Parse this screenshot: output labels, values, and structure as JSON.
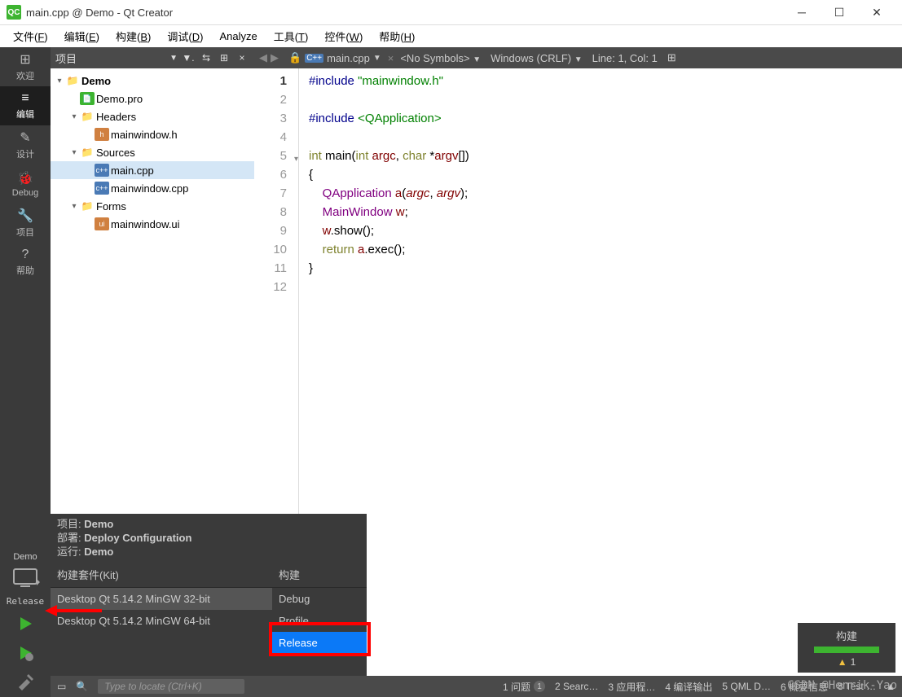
{
  "window": {
    "title": "main.cpp @ Demo - Qt Creator",
    "logo_text": "QC"
  },
  "menu": [
    {
      "label": "文件",
      "key": "F"
    },
    {
      "label": "编辑",
      "key": "E"
    },
    {
      "label": "构建",
      "key": "B"
    },
    {
      "label": "调试",
      "key": "D"
    },
    {
      "label": "Analyze",
      "key": ""
    },
    {
      "label": "工具",
      "key": "T"
    },
    {
      "label": "控件",
      "key": "W"
    },
    {
      "label": "帮助",
      "key": "H"
    }
  ],
  "sidebar": {
    "items": [
      {
        "id": "welcome",
        "label": "欢迎",
        "icon": "⊞"
      },
      {
        "id": "edit",
        "label": "编辑",
        "icon": "≡",
        "active": true
      },
      {
        "id": "design",
        "label": "设计",
        "icon": "✎"
      },
      {
        "id": "debug",
        "label": "Debug",
        "icon": "🐞"
      },
      {
        "id": "project",
        "label": "项目",
        "icon": "🔧"
      },
      {
        "id": "help",
        "label": "帮助",
        "icon": "?"
      }
    ],
    "target": {
      "name": "Demo",
      "config": "Release"
    }
  },
  "project_panel": {
    "header": "项目"
  },
  "tree": [
    {
      "indent": 0,
      "arrow": "▾",
      "icon": "folder",
      "name": "Demo",
      "bold": true
    },
    {
      "indent": 1,
      "arrow": "",
      "icon": "pro",
      "name": "Demo.pro"
    },
    {
      "indent": 1,
      "arrow": "▾",
      "icon": "subfolder",
      "name": "Headers"
    },
    {
      "indent": 2,
      "arrow": "",
      "icon": "h",
      "name": "mainwindow.h"
    },
    {
      "indent": 1,
      "arrow": "▾",
      "icon": "subfolder",
      "name": "Sources"
    },
    {
      "indent": 2,
      "arrow": "",
      "icon": "cpp",
      "name": "main.cpp",
      "selected": true
    },
    {
      "indent": 2,
      "arrow": "",
      "icon": "cpp",
      "name": "mainwindow.cpp"
    },
    {
      "indent": 1,
      "arrow": "▾",
      "icon": "subfolder",
      "name": "Forms"
    },
    {
      "indent": 2,
      "arrow": "",
      "icon": "ui",
      "name": "mainwindow.ui"
    }
  ],
  "editor": {
    "file": "main.cpp",
    "symbols": "<No Symbols>",
    "encoding": "Windows (CRLF)",
    "position": "Line: 1, Col: 1"
  },
  "code_lines": 12,
  "popup": {
    "info_project_lbl": "项目: ",
    "info_project": "Demo",
    "info_deploy_lbl": "部署: ",
    "info_deploy": "Deploy Configuration",
    "info_run_lbl": "运行: ",
    "info_run": "Demo",
    "kit_header": "构建套件(Kit)",
    "build_header": "构建",
    "kits": [
      "Desktop Qt 5.14.2 MinGW 32-bit",
      "Desktop Qt 5.14.2 MinGW 64-bit"
    ],
    "builds": [
      "Debug",
      "Profile",
      "Release"
    ],
    "selected_kit": 0,
    "selected_build": 2
  },
  "statusbar": {
    "search_placeholder": "Type to locate (Ctrl+K)",
    "items": [
      "1 问题",
      "2 Searc…",
      "3 应用程…",
      "4 编译输出",
      "5 QML D…",
      "6 概要信息",
      "8 Test …"
    ],
    "issue_count": "1"
  },
  "build_indicator": {
    "label": "构建",
    "warn_count": "1"
  },
  "watermark": "CSDN @Henrik-Yao"
}
